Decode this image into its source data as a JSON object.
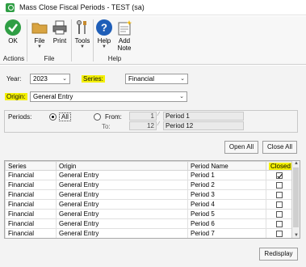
{
  "window": {
    "title": "Mass Close Fiscal Periods  -  TEST (sa)"
  },
  "toolbar": {
    "ok_label": "OK",
    "file_label": "File",
    "print_label": "Print",
    "tools_label": "Tools",
    "help_label": "Help",
    "add_note_label": "Add\nNote",
    "groups": {
      "actions": "Actions",
      "file": "File",
      "help": "Help"
    }
  },
  "form": {
    "year_label": "Year:",
    "year_value": "2023",
    "series_label": "Series:",
    "series_value": "Financial",
    "origin_label": "Origin:",
    "origin_value": "General Entry",
    "periods_label": "Periods:",
    "all_label": "All",
    "from_label": "From:",
    "to_label": "To:",
    "from_number": "1",
    "from_name": "Period 1",
    "to_number": "12",
    "to_name": "Period 12",
    "open_all_label": "Open All",
    "close_all_label": "Close All",
    "redisplay_label": "Redisplay"
  },
  "grid": {
    "columns": [
      "Series",
      "Origin",
      "Period Name",
      "Closed"
    ],
    "rows": [
      {
        "series": "Financial",
        "origin": "General Entry",
        "period": "Period 1",
        "closed": true
      },
      {
        "series": "Financial",
        "origin": "General Entry",
        "period": "Period 2",
        "closed": false
      },
      {
        "series": "Financial",
        "origin": "General Entry",
        "period": "Period 3",
        "closed": false
      },
      {
        "series": "Financial",
        "origin": "General Entry",
        "period": "Period 4",
        "closed": false
      },
      {
        "series": "Financial",
        "origin": "General Entry",
        "period": "Period 5",
        "closed": false
      },
      {
        "series": "Financial",
        "origin": "General Entry",
        "period": "Period 6",
        "closed": false
      },
      {
        "series": "Financial",
        "origin": "General Entry",
        "period": "Period 7",
        "closed": false
      }
    ]
  },
  "colors": {
    "highlight": "#f4f000",
    "ok_green": "#2f9e44",
    "help_blue": "#1e5eb8"
  }
}
